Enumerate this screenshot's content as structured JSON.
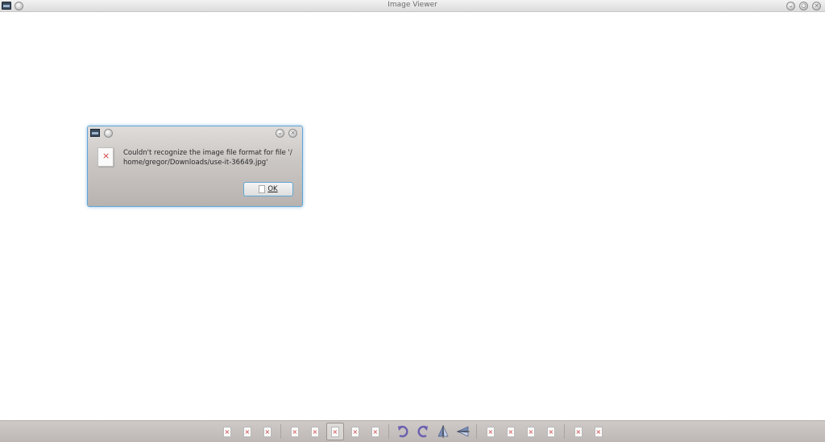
{
  "window": {
    "title": "Image Viewer"
  },
  "dialog": {
    "message_line1": "Couldn't recognize the image file format for file '/",
    "message_line2": "home/gregor/Downloads/use-it-36649.jpg'",
    "ok_label": "OK"
  },
  "toolbar": {
    "groups": [
      [
        "doc-1",
        "doc-2",
        "doc-3"
      ],
      [
        "doc-4",
        "doc-5",
        "doc-6-active",
        "doc-7",
        "doc-8"
      ],
      [
        "rotate-right-icon",
        "rotate-left-icon",
        "flip-vertical-icon",
        "flip-horizontal-icon"
      ],
      [
        "doc-9",
        "doc-10",
        "doc-11",
        "doc-12"
      ],
      [
        "doc-13",
        "doc-14"
      ]
    ]
  },
  "colors": {
    "accent": "#5fa6d6",
    "error_mark": "#d23c3c",
    "toolbar_bg": "#c6c1be",
    "rotate_icon": "#6b5fb0"
  }
}
